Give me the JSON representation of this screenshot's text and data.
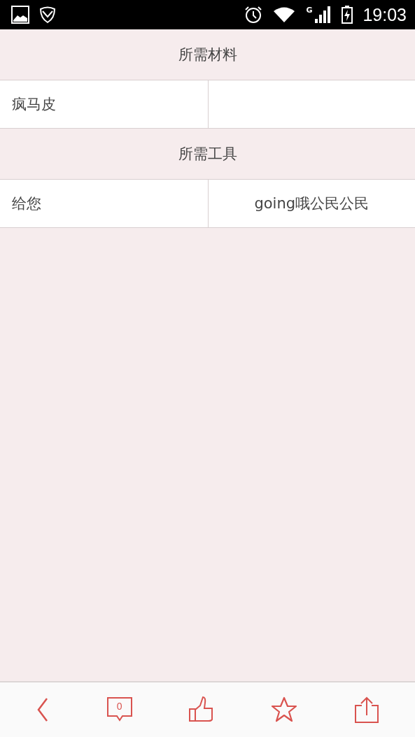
{
  "status_bar": {
    "network": "G",
    "time": "19:03"
  },
  "sections": [
    {
      "title": "所需材料",
      "rows": [
        {
          "column_1": "疯马皮"
        }
      ]
    },
    {
      "title": "所需工具",
      "rows": [
        {
          "column_1": "给您",
          "column_2": "going哦公民公民"
        }
      ]
    }
  ],
  "toolbar": {
    "comment_count": "0"
  }
}
